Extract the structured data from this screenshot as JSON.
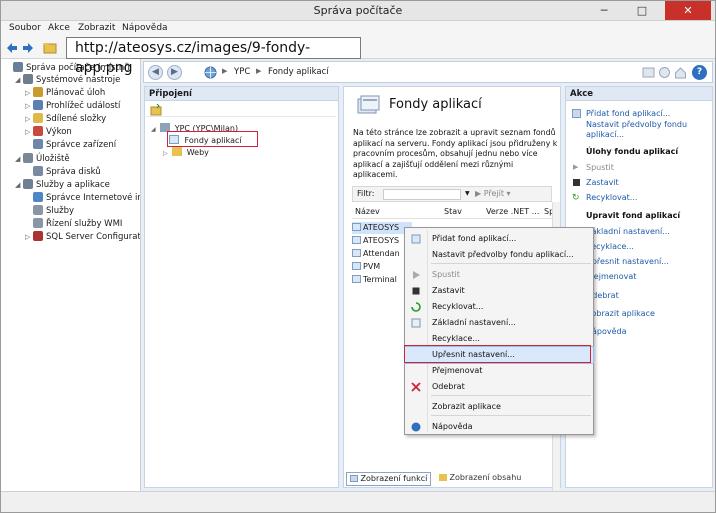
{
  "window": {
    "title": "Správa počítače",
    "btn_min": "─",
    "btn_max": "□",
    "btn_close": "✕"
  },
  "menubar": [
    "Soubor",
    "Akce",
    "Zobrazit",
    "Nápověda"
  ],
  "address_overlay": "http://ateosys.cz/images/9-fondy-app.png",
  "tree": [
    {
      "label": "Správa počítače (místní)",
      "level": 0,
      "expander": "",
      "color": "#6a7f99"
    },
    {
      "label": "Systémové nástroje",
      "level": 1,
      "expander": "◢",
      "color": "#6f7c8c"
    },
    {
      "label": "Plánovač úloh",
      "level": 2,
      "expander": "▷",
      "color": "#c99a2e"
    },
    {
      "label": "Prohlížeč událostí",
      "level": 2,
      "expander": "▷",
      "color": "#5b7fb0"
    },
    {
      "label": "Sdílené složky",
      "level": 2,
      "expander": "▷",
      "color": "#e0b84a"
    },
    {
      "label": "Výkon",
      "level": 2,
      "expander": "▷",
      "color": "#c84a3a"
    },
    {
      "label": "Správce zařízení",
      "level": 2,
      "expander": "",
      "color": "#6d87a8"
    },
    {
      "label": "Úložiště",
      "level": 1,
      "expander": "◢",
      "color": "#7a8796"
    },
    {
      "label": "Správa disků",
      "level": 2,
      "expander": "",
      "color": "#7b8aa0"
    },
    {
      "label": "Služby a aplikace",
      "level": 1,
      "expander": "◢",
      "color": "#6f8094"
    },
    {
      "label": "Správce Internetové info",
      "level": 2,
      "expander": "",
      "color": "#4f86c6"
    },
    {
      "label": "Služby",
      "level": 2,
      "expander": "",
      "color": "#8a96a6"
    },
    {
      "label": "Řízení služby WMI",
      "level": 2,
      "expander": "",
      "color": "#8a96a6"
    },
    {
      "label": "SQL Server Configurati",
      "level": 2,
      "expander": "▷",
      "color": "#a33"
    }
  ],
  "breadcrumb": {
    "back": "◀",
    "forward": "▶",
    "sep": "▶",
    "items": [
      "YPC",
      "Fondy aplikací"
    ],
    "help": "?"
  },
  "connections": {
    "header": "Připojení",
    "nodes": [
      {
        "label": "YPC (YPC\\Milan)",
        "expander": "◢"
      },
      {
        "label": "Fondy aplikací",
        "expander": ""
      },
      {
        "label": "Weby",
        "expander": "▷"
      }
    ]
  },
  "center": {
    "title": "Fondy aplikací",
    "description": "Na této stránce lze zobrazit a upravit seznam fondů aplikací na serveru. Fondy aplikací jsou přidruženy k pracovním procesům, obsahují jednu nebo více aplikací a zajišťují oddělení mezi různými aplikacemi.",
    "filter_label": "Filtr:",
    "filter_go": "Přejít",
    "columns": [
      "Název",
      "Stav",
      "Verze .NET ...",
      "Sp"
    ],
    "rows": [
      "ATEOSYS",
      "ATEOSYS",
      "Attendan",
      "PVM",
      "Terminal"
    ],
    "tab_features": "Zobrazení funkcí",
    "tab_content": "Zobrazení obsahu"
  },
  "actions": {
    "header": "Akce",
    "top_links": [
      "Přidat fond aplikací...",
      "Nastavit předvolby fondu",
      "aplikací..."
    ],
    "section1": "Úlohy fondu aplikací",
    "start": "Spustit",
    "stop": "Zastavit",
    "recycle": "Recyklovat...",
    "section2": "Upravit fond aplikací",
    "edit_links": [
      "Základní nastavení...",
      "Recyklace...",
      "Upřesnit nastavení...",
      "Přejmenovat"
    ],
    "remove": "Odebrat",
    "view_apps": "Zobrazit aplikace",
    "help": "Nápověda"
  },
  "context_menu": {
    "items": [
      {
        "label": "Přidat fond aplikací...",
        "disabled": false
      },
      {
        "label": "Nastavit předvolby fondu aplikací...",
        "disabled": false
      },
      {
        "label": "Spustit",
        "disabled": true
      },
      {
        "label": "Zastavit",
        "disabled": false
      },
      {
        "label": "Recyklovat...",
        "disabled": false
      },
      {
        "label": "Základní nastavení...",
        "disabled": false
      },
      {
        "label": "Recyklace...",
        "disabled": false
      },
      {
        "label": "Upřesnit nastavení...",
        "disabled": false
      },
      {
        "label": "Přejmenovat",
        "disabled": false
      },
      {
        "label": "Odebrat",
        "disabled": false
      },
      {
        "label": "Zobrazit aplikace",
        "disabled": false
      },
      {
        "label": "Nápověda",
        "disabled": false
      }
    ],
    "highlighted_index": 7
  },
  "colors": {
    "highlight": "#d0233a",
    "link": "#1e5aa8",
    "pane_header": "#dfe8f4",
    "close_button": "#c7312a"
  }
}
